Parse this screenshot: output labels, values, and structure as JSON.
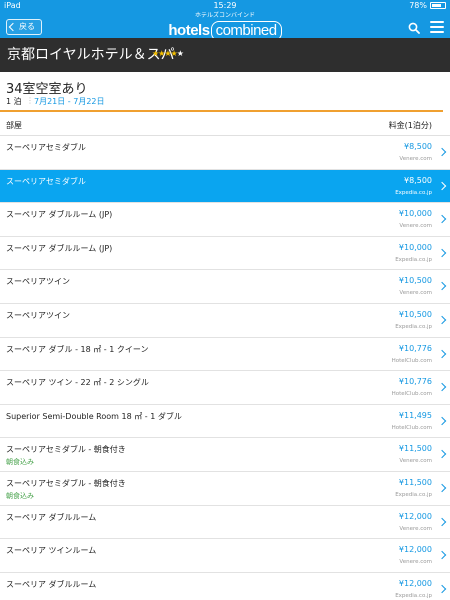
{
  "status_bar": {
    "device": "iPad",
    "time": "15:29",
    "battery_text": "78%",
    "battery_level": 0.78
  },
  "nav": {
    "back_label": "戻る",
    "logo_tagline": "ホテルズコンバインド",
    "logo_brand_a": "hotels",
    "logo_brand_b": "combined"
  },
  "hotel": {
    "name": "京都ロイヤルホテル＆スパ",
    "stars": 4,
    "max_stars": 5
  },
  "summary": {
    "availability": "34室空室あり",
    "nights": "1 泊",
    "dates": "7月21日 - 7月22日"
  },
  "columns": {
    "room": "部屋",
    "price": "料金(1泊分)"
  },
  "rooms": [
    {
      "name": "スーペリアセミダブル",
      "meal": "",
      "price": "¥8,500",
      "site": "Venere.com",
      "selected": false
    },
    {
      "name": "スーペリアセミダブル",
      "meal": "",
      "price": "¥8,500",
      "site": "Expedia.co.jp",
      "selected": true
    },
    {
      "name": "スーペリア ダブルルーム (JP)",
      "meal": "",
      "price": "¥10,000",
      "site": "Venere.com",
      "selected": false
    },
    {
      "name": "スーペリア ダブルルーム (JP)",
      "meal": "",
      "price": "¥10,000",
      "site": "Expedia.co.jp",
      "selected": false
    },
    {
      "name": "スーペリアツイン",
      "meal": "",
      "price": "¥10,500",
      "site": "Venere.com",
      "selected": false
    },
    {
      "name": "スーペリアツイン",
      "meal": "",
      "price": "¥10,500",
      "site": "Expedia.co.jp",
      "selected": false
    },
    {
      "name": "スーペリア ダブル - 18 ㎡ - 1 クイーン",
      "meal": "",
      "price": "¥10,776",
      "site": "HotelClub.com",
      "selected": false
    },
    {
      "name": "スーペリア ツイン - 22 ㎡ - 2 シングル",
      "meal": "",
      "price": "¥10,776",
      "site": "HotelClub.com",
      "selected": false
    },
    {
      "name": "Superior Semi-Double Room 18 ㎡ - 1 ダブル",
      "meal": "",
      "price": "¥11,495",
      "site": "HotelClub.com",
      "selected": false
    },
    {
      "name": "スーペリアセミダブル - 朝食付き",
      "meal": "朝食込み",
      "price": "¥11,500",
      "site": "Venere.com",
      "selected": false
    },
    {
      "name": "スーペリアセミダブル - 朝食付き",
      "meal": "朝食込み",
      "price": "¥11,500",
      "site": "Expedia.co.jp",
      "selected": false
    },
    {
      "name": "スーペリア ダブルルーム",
      "meal": "",
      "price": "¥12,000",
      "site": "Venere.com",
      "selected": false
    },
    {
      "name": "スーペリア ツインルーム",
      "meal": "",
      "price": "¥12,000",
      "site": "Venere.com",
      "selected": false
    },
    {
      "name": "スーペリア ダブルルーム",
      "meal": "",
      "price": "¥12,000",
      "site": "Expedia.co.jp",
      "selected": false
    }
  ]
}
